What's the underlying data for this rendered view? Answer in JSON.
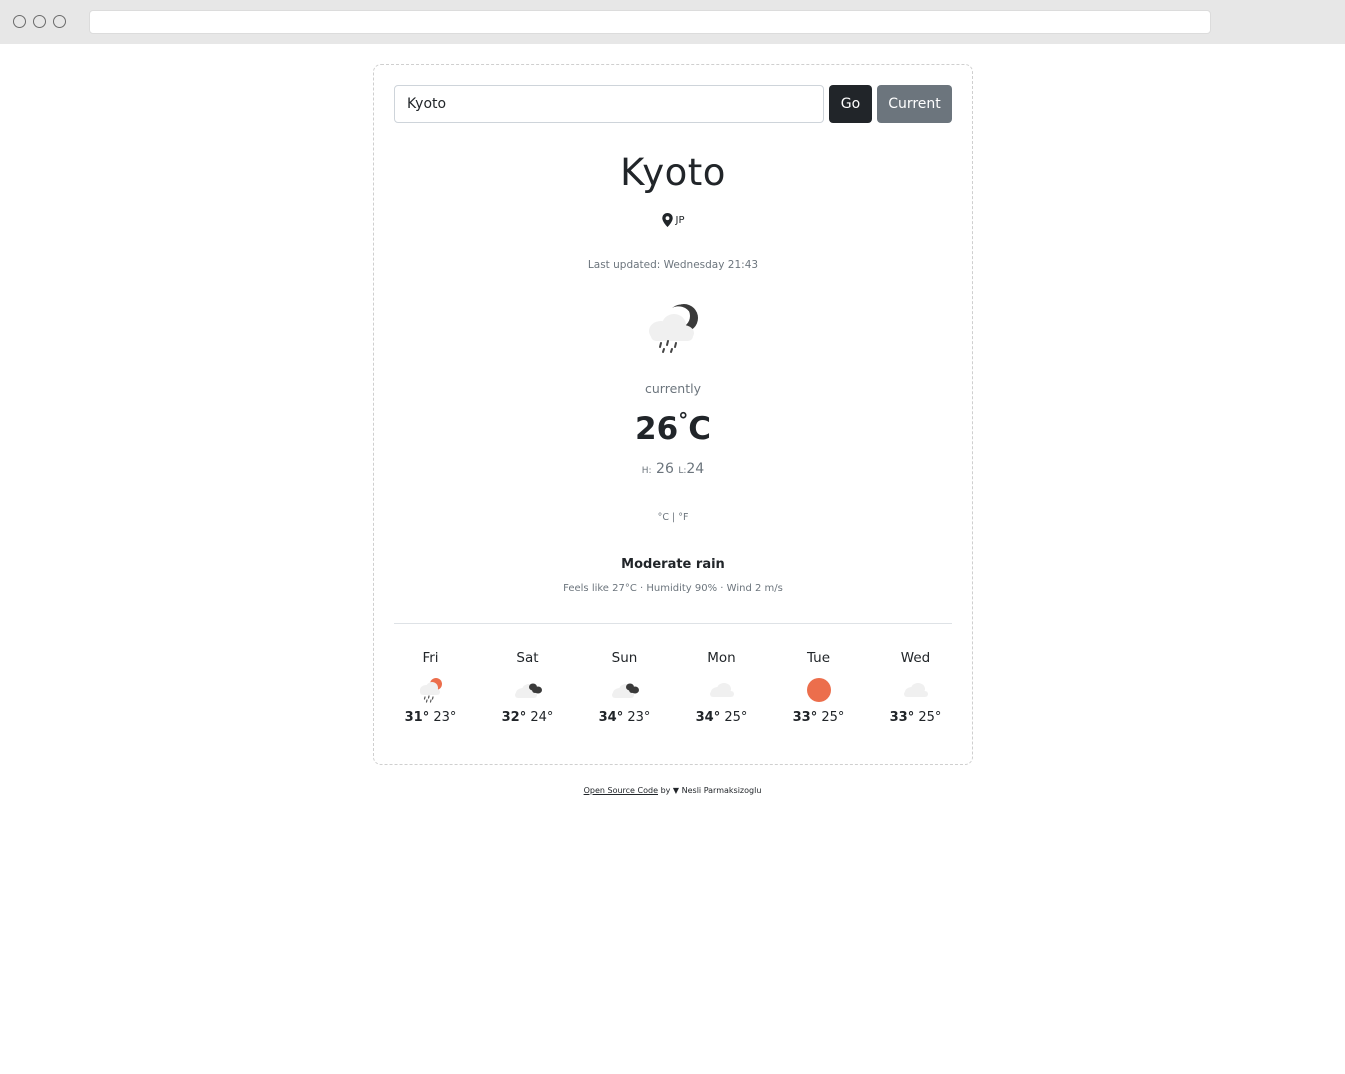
{
  "search": {
    "value": "Kyoto",
    "go_label": "Go",
    "current_label": "Current"
  },
  "location": {
    "city": "Kyoto",
    "country": "JP"
  },
  "updated": "Last updated: Wednesday 21:43",
  "current": {
    "label": "currently",
    "temperature": "26",
    "unit": "C",
    "high_label": "H:",
    "high": "26",
    "low_label": "L:",
    "low": "24",
    "unit_toggle": "°C | °F",
    "condition": "Moderate rain",
    "details": "Feels like 27°C · Humidity 90% · Wind 2 m/s",
    "icon": "night-cloud-rain-icon"
  },
  "forecast": [
    {
      "day": "Fri",
      "high": "31°",
      "low": "23°",
      "icon": "sun-cloud-rain-icon"
    },
    {
      "day": "Sat",
      "high": "32°",
      "low": "24°",
      "icon": "cloudy-icon"
    },
    {
      "day": "Sun",
      "high": "34°",
      "low": "23°",
      "icon": "cloudy-icon"
    },
    {
      "day": "Mon",
      "high": "34°",
      "low": "25°",
      "icon": "cloud-icon"
    },
    {
      "day": "Tue",
      "high": "33°",
      "low": "25°",
      "icon": "sun-icon"
    },
    {
      "day": "Wed",
      "high": "33°",
      "low": "25°",
      "icon": "cloud-icon"
    }
  ],
  "footer": {
    "link": "Open Source Code",
    "by": "by",
    "heart": "▼",
    "author": "Nesli Parmaksizoglu"
  },
  "colors": {
    "accent": "#ec6e4c",
    "dark": "#212529",
    "secondary": "#6c757d"
  }
}
